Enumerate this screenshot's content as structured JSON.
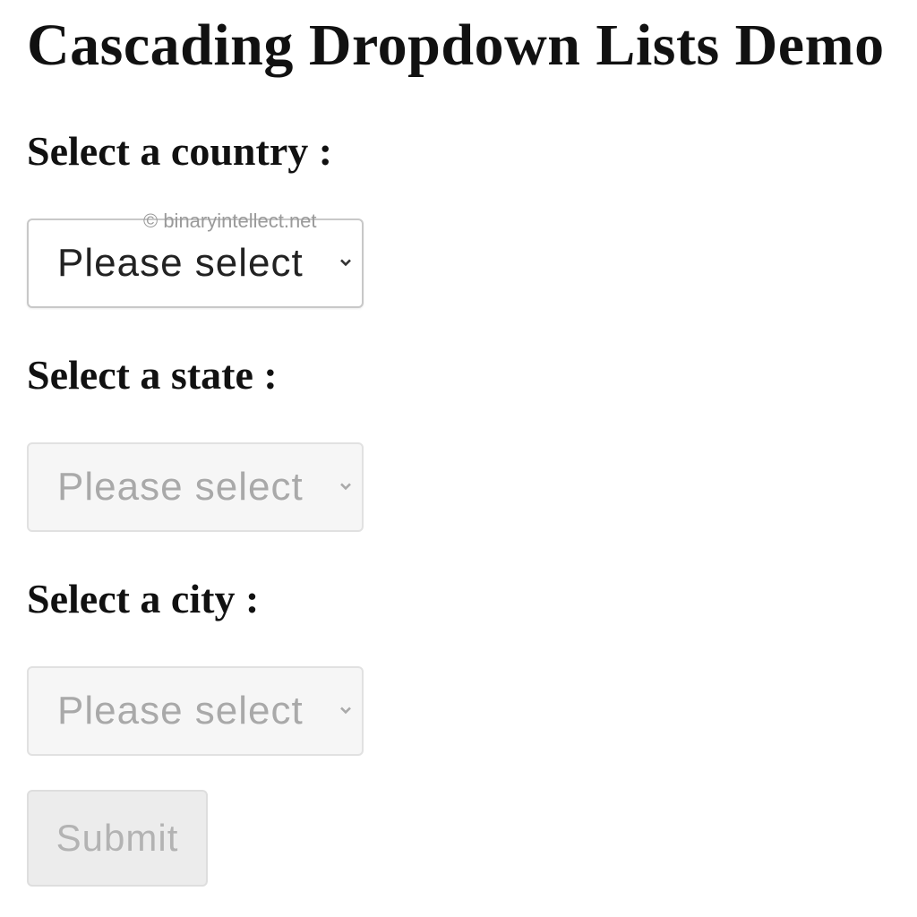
{
  "page": {
    "title": "Cascading Dropdown Lists Demo",
    "watermark": "© binaryintellect.net"
  },
  "form": {
    "country": {
      "label": "Select a country :",
      "selected": "Please select",
      "disabled": false
    },
    "state": {
      "label": "Select a state :",
      "selected": "Please select",
      "disabled": true
    },
    "city": {
      "label": "Select a city :",
      "selected": "Please select",
      "disabled": true
    },
    "submit": {
      "label": "Submit",
      "disabled": true
    }
  },
  "icons": {
    "dropdown": "chevron-down-icon"
  },
  "colors": {
    "enabled_text": "#222222",
    "disabled_text": "#a9a9a9",
    "disabled_bg": "#f6f6f6",
    "button_bg": "#ececec"
  }
}
